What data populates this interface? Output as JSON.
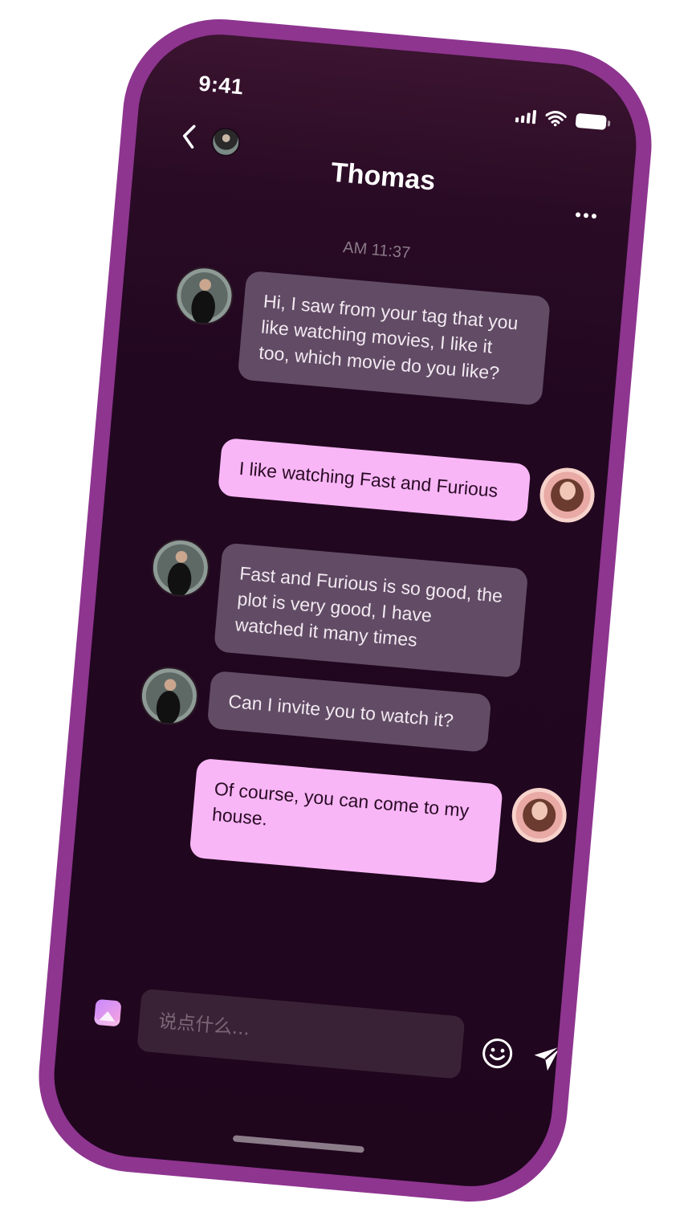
{
  "status_bar": {
    "time": "9:41"
  },
  "header": {
    "title": "Thomas",
    "back_icon": "chevron-left-icon",
    "more_icon": "ellipsis-icon"
  },
  "chat": {
    "timestamp": "AM 11:37",
    "messages": [
      {
        "from": "Thomas",
        "text": "Hi, I saw from your tag that you like watching movies, I like it too, which movie do you like?"
      },
      {
        "from": "me",
        "text": "I like watching Fast and Furious"
      },
      {
        "from": "Thomas",
        "text": "Fast and Furious is so good, the plot is very good, I have watched it many times"
      },
      {
        "from": "Thomas",
        "text": "Can I invite you to watch it?"
      },
      {
        "from": "me",
        "text": "Of course, you can come to my house."
      }
    ]
  },
  "composer": {
    "placeholder": "说点什么...",
    "value": "",
    "image_icon": "image-icon",
    "emoji_icon": "emoji-icon",
    "send_icon": "send-icon"
  },
  "colors": {
    "frame": "#8e3590",
    "background": "#220720",
    "incoming_bubble": "#614b65",
    "outgoing_bubble": "#f8b6f6"
  }
}
